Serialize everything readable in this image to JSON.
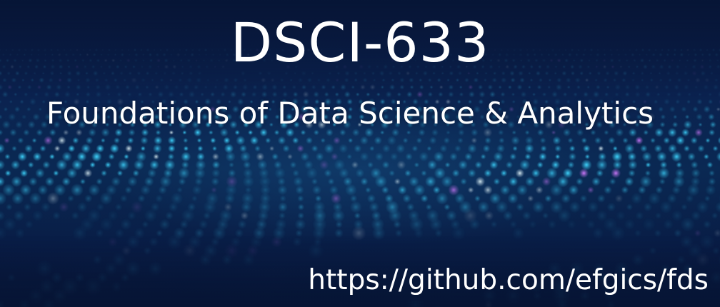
{
  "banner": {
    "title": "DSCI-633",
    "subtitle": "Foundations of Data Science & Analytics",
    "url": "https://github.com/efgics/fds"
  },
  "colors": {
    "background": "#071535",
    "text": "#ffffff",
    "dot_cyan": "#3fd6ff",
    "dot_white": "#e8fbff",
    "dot_magenta": "#d27bff"
  }
}
